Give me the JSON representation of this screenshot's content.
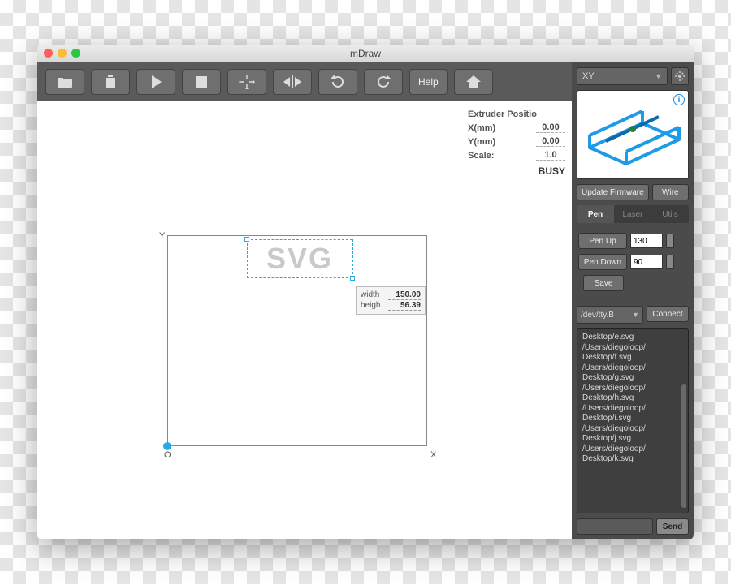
{
  "window": {
    "title": "mDraw"
  },
  "toolbar": {
    "help_label": "Help"
  },
  "status": {
    "heading": "Extruder Positio",
    "x_label": "X(mm)",
    "x_val": "0.00",
    "y_label": "Y(mm)",
    "y_val": "0.00",
    "scale_label": "Scale:",
    "scale_val": "1.0",
    "busy": "BUSY"
  },
  "canvas": {
    "svg_text": "SVG",
    "axis_y": "Y",
    "axis_o": "O",
    "axis_x": "X",
    "dim_width_label": "width",
    "dim_width_val": "150.00",
    "dim_height_label": "heigh",
    "dim_height_val": "56.39"
  },
  "sidebar": {
    "robot_select": "XY",
    "firmware_btn": "Update Firmware",
    "wire_btn": "Wire",
    "tabs": {
      "pen": "Pen",
      "laser": "Laser",
      "utils": "Utils"
    },
    "pen": {
      "penup_label": "Pen Up",
      "penup_val": "130",
      "pendown_label": "Pen Down",
      "pendown_val": "90",
      "save_label": "Save"
    },
    "port": {
      "selected": "/dev/tty.B",
      "connect_label": "Connect"
    },
    "log_lines": [
      "Desktop/e.svg",
      "/Users/diegoloop/",
      "Desktop/f.svg",
      "/Users/diegoloop/",
      "Desktop/g.svg",
      "/Users/diegoloop/",
      "Desktop/h.svg",
      "/Users/diegoloop/",
      "Desktop/i.svg",
      "/Users/diegoloop/",
      "Desktop/j.svg",
      "/Users/diegoloop/",
      "Desktop/k.svg"
    ],
    "send_label": "Send"
  }
}
